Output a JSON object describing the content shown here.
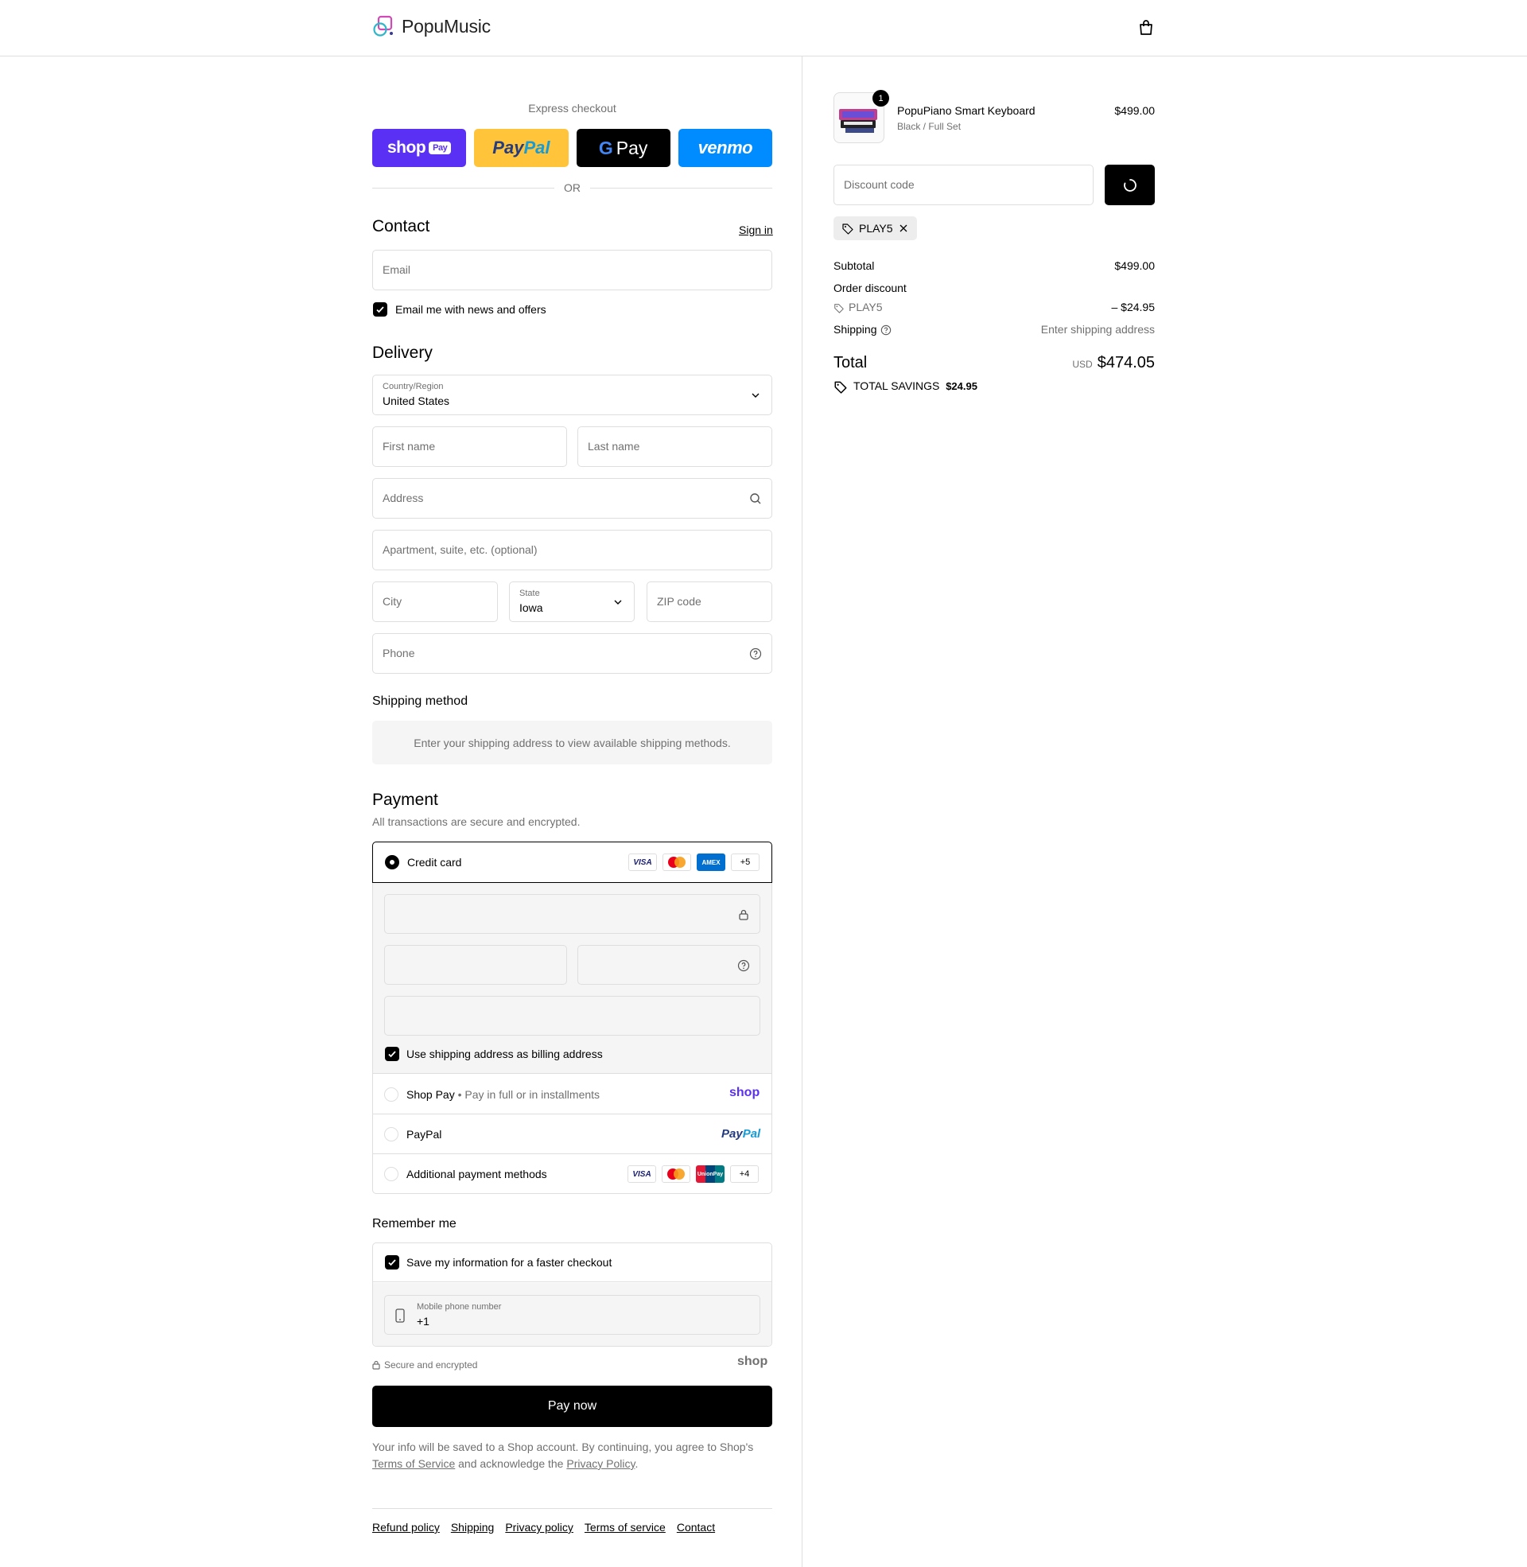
{
  "header": {
    "brand": "PopuMusic"
  },
  "express": {
    "title": "Express checkout",
    "shop_pay": "shop",
    "shop_pay_pill": "Pay",
    "paypal_a": "Pay",
    "paypal_b": "Pal",
    "gpay": "Pay",
    "gpay_g": "G",
    "venmo": "venmo",
    "or": "OR"
  },
  "contact": {
    "title": "Contact",
    "sign_in": "Sign in",
    "email_placeholder": "Email",
    "newsletter_label": "Email me with news and offers"
  },
  "delivery": {
    "title": "Delivery",
    "country_label": "Country/Region",
    "country_value": "United States",
    "first_name": "First name",
    "last_name": "Last name",
    "address": "Address",
    "apartment": "Apartment, suite, etc. (optional)",
    "city": "City",
    "state_label": "State",
    "state_value": "Iowa",
    "zip": "ZIP code",
    "phone": "Phone"
  },
  "shipping_method": {
    "title": "Shipping method",
    "message": "Enter your shipping address to view available shipping methods."
  },
  "payment": {
    "title": "Payment",
    "subtitle": "All transactions are secure and encrypted.",
    "credit_card": "Credit card",
    "card_more": "+5",
    "billing_same": "Use shipping address as billing address",
    "shop_pay": "Shop Pay",
    "shop_pay_sep": "•",
    "shop_pay_note": "Pay in full or in installments",
    "shop_logo": "shop",
    "paypal": "PayPal",
    "paypal_logo_a": "Pay",
    "paypal_logo_b": "Pal",
    "additional": "Additional payment methods",
    "additional_more": "+4",
    "visa": "VISA",
    "amex": "AMEX",
    "unionpay": "UnionPay"
  },
  "remember": {
    "title": "Remember me",
    "save_label": "Save my information for a faster checkout",
    "mobile_label": "Mobile phone number",
    "mobile_value": "+1",
    "secure": "Secure and encrypted",
    "shop_logo": "shop"
  },
  "pay_now": "Pay now",
  "legal": {
    "line1": "Your info will be saved to a Shop account. By continuing, you agree to Shop's",
    "tos": "Terms of Service",
    "and": "and acknowledge the",
    "privacy": "Privacy Policy",
    "end": "."
  },
  "footer": {
    "links": [
      "Refund policy",
      "Shipping",
      "Privacy policy",
      "Terms of service",
      "Contact"
    ]
  },
  "summary": {
    "product_name": "PopuPiano Smart Keyboard",
    "product_variant": "Black / Full Set",
    "product_price": "$499.00",
    "quantity": "1",
    "discount_placeholder": "Discount code",
    "applied_code": "PLAY5",
    "subtotal_label": "Subtotal",
    "subtotal_value": "$499.00",
    "order_discount_label": "Order discount",
    "discount_code": "PLAY5",
    "discount_value": "– $24.95",
    "shipping_label": "Shipping",
    "shipping_value": "Enter shipping address",
    "total_label": "Total",
    "currency": "USD",
    "total_value": "$474.05",
    "savings_label": "TOTAL SAVINGS",
    "savings_value": "$24.95"
  }
}
